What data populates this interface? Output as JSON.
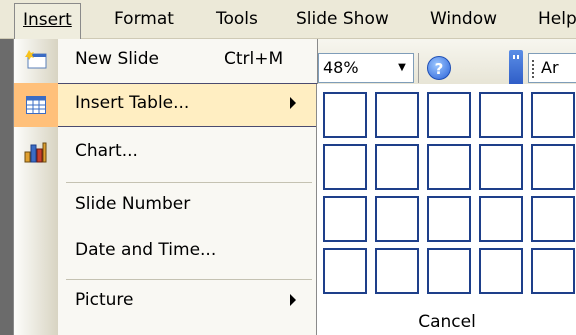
{
  "menubar": {
    "items": [
      {
        "label": "Insert",
        "open": true
      },
      {
        "label": "Format"
      },
      {
        "label": "Tools"
      },
      {
        "label": "Slide Show"
      },
      {
        "label": "Window"
      },
      {
        "label": "Help"
      }
    ]
  },
  "toolbar": {
    "zoom_value": "48%",
    "font_value": "Ar"
  },
  "insert_menu": {
    "items": [
      {
        "label": "New Slide",
        "shortcut": "Ctrl+M",
        "icon": "new-slide-icon"
      },
      {
        "label": "Insert Table...",
        "icon": "table-icon",
        "submenu": true,
        "highlighted": true
      },
      {
        "label": "Chart...",
        "icon": "chart-icon"
      },
      {
        "label": "Slide Number"
      },
      {
        "label": "Date and Time..."
      },
      {
        "label": "Picture",
        "submenu": true
      }
    ]
  },
  "table_grid": {
    "cancel_label": "Cancel"
  },
  "colors": {
    "menu_bg": "#ECE9D8",
    "highlight": "#FFEEC2",
    "highlight_icon": "#FFC07A",
    "grid_border": "#1e3f8a"
  }
}
